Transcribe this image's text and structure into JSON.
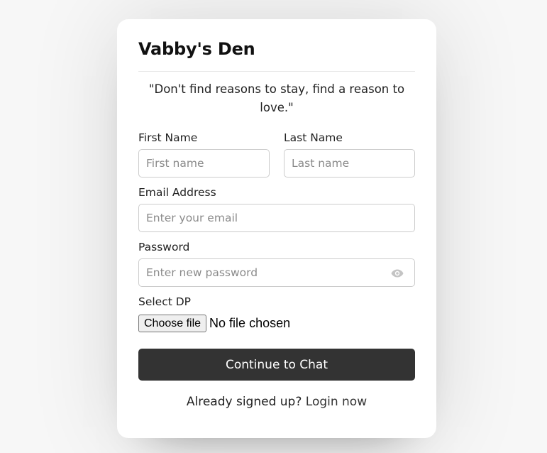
{
  "form": {
    "title": "Vabby's Den",
    "quote": "\"Don't find reasons to stay, find a reason to love.\"",
    "first_name": {
      "label": "First Name",
      "placeholder": "First name"
    },
    "last_name": {
      "label": "Last Name",
      "placeholder": "Last name"
    },
    "email": {
      "label": "Email Address",
      "placeholder": "Enter your email"
    },
    "password": {
      "label": "Password",
      "placeholder": "Enter new password",
      "toggle_icon": "eye-icon"
    },
    "dp": {
      "label": "Select DP",
      "button_label": "Choose file",
      "status": "No file chosen"
    },
    "submit_label": "Continue to Chat",
    "footer_text": "Already signed up?",
    "footer_link": "Login now"
  },
  "colors": {
    "page_bg": "#f7f7f7",
    "card_bg": "#ffffff",
    "button_bg": "#333333",
    "input_border": "#cccccc"
  }
}
